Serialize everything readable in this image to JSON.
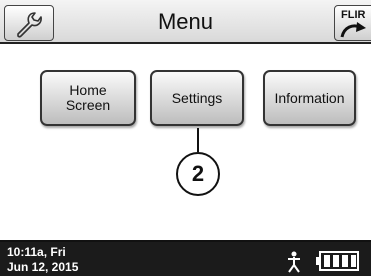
{
  "header": {
    "title": "Menu",
    "left_icon": "wrench-icon",
    "right_button": {
      "label": "FLIR",
      "icon": "refresh-arrow-icon"
    }
  },
  "menu": {
    "buttons": [
      {
        "label": "Home\nScreen"
      },
      {
        "label": "Settings"
      },
      {
        "label": "Information"
      }
    ]
  },
  "callout": {
    "number": "2"
  },
  "status_bar": {
    "time": "10:11a, Fri",
    "date": "Jun 12, 2015",
    "person_icon": "person-icon",
    "battery_icon": "battery-icon"
  },
  "colors": {
    "status_bar_bg": "#1b1b1b",
    "status_text": "#ffffff",
    "button_face": "#d9d9d9"
  }
}
